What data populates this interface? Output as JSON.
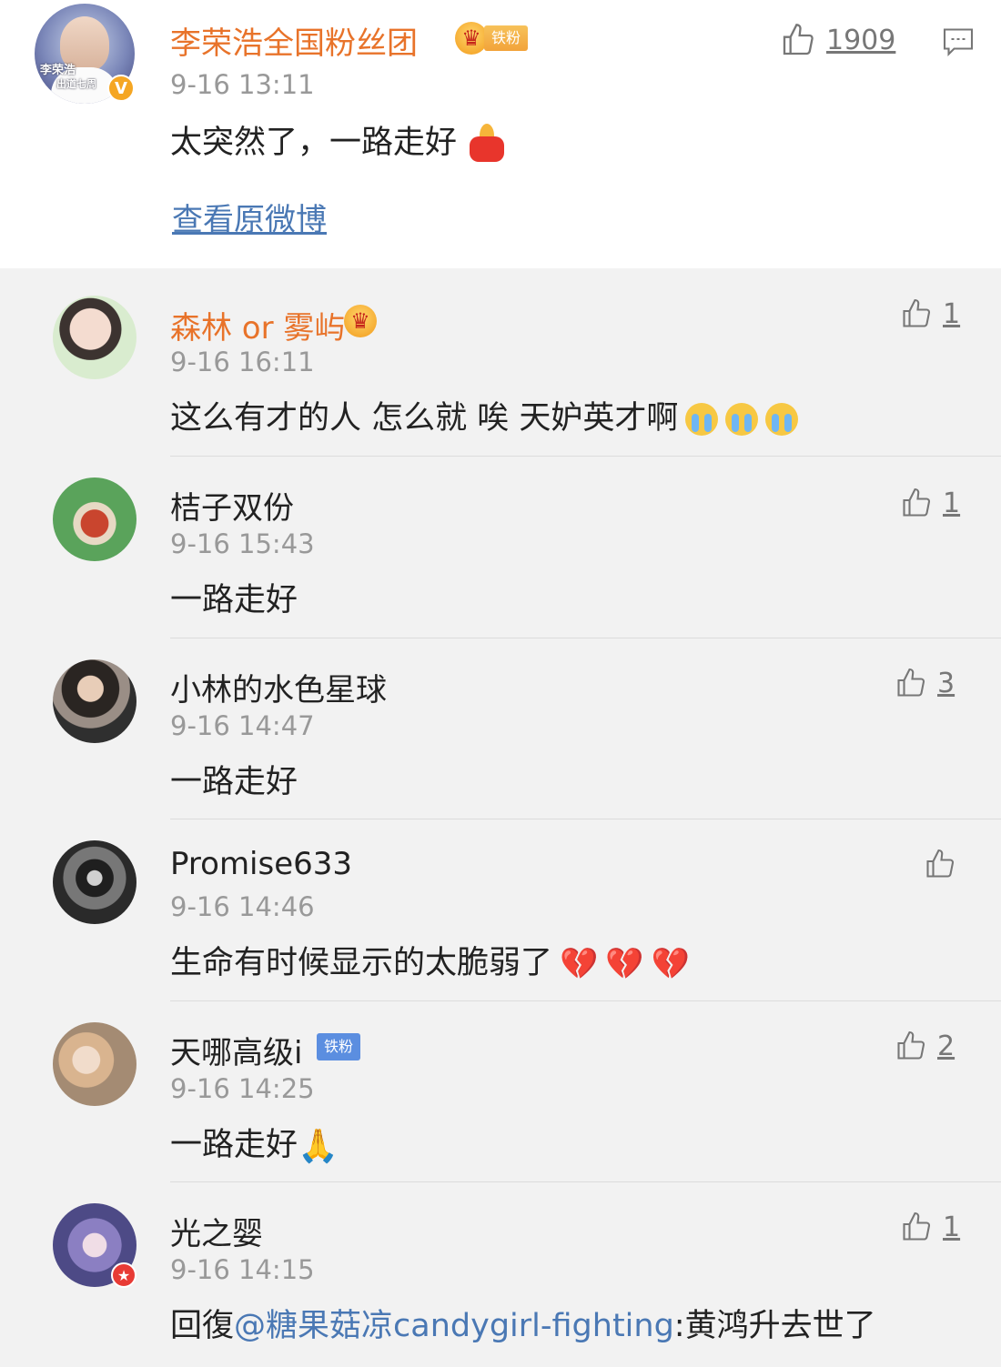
{
  "main_post": {
    "author": "李荣浩全国粉丝团",
    "badge_label": "铁粉",
    "avatar_caption_1": "李荣浩",
    "avatar_caption_2": "出道七周",
    "verified": "V",
    "time": "9-16 13:11",
    "content": "太突然了，一路走好",
    "content_emoji": "candle-emoji",
    "likes": "1909",
    "view_original": "查看原微博"
  },
  "comments": [
    {
      "author": "森林 or 雾屿",
      "author_color": "#e8732a",
      "badge": "crown",
      "time": "9-16 16:11",
      "content": "这么有才的人 怎么就 唉 天妒英才啊",
      "emoji": "crying-face-emoji x3",
      "likes": "1",
      "avatar_color": "#d7e8d1"
    },
    {
      "author": "桔子双份",
      "time": "9-16 15:43",
      "content": "一路走好",
      "likes": "1",
      "avatar_color": "#5aa35b"
    },
    {
      "author": "小林的水色星球",
      "time": "9-16 14:47",
      "content": "一路走好",
      "likes": "3",
      "avatar_color": "#3b3b3b"
    },
    {
      "author": "Promise633",
      "time": "9-16 14:46",
      "content": "生命有时候显示的太脆弱了",
      "emoji": "broken-heart-emoji x3",
      "likes": "",
      "avatar_color": "#555555"
    },
    {
      "author": "天哪高级i",
      "badge_label": "铁粉",
      "time": "9-16 14:25",
      "content": "一路走好",
      "emoji": "folded-hands-emoji",
      "likes": "2",
      "avatar_color": "#c9b39a"
    },
    {
      "author": "光之婴",
      "time": "9-16 14:15",
      "content_prefix": "回復",
      "mention": "@糖果菇凉candygirl-fighting",
      "content_suffix": ":黄鸿升去世了",
      "likes": "1",
      "avatar_color": "#7d78b6"
    }
  ],
  "colors": {
    "accent_orange": "#e8732a",
    "link_blue": "#4a78b4",
    "background": "#f2f2f2"
  }
}
